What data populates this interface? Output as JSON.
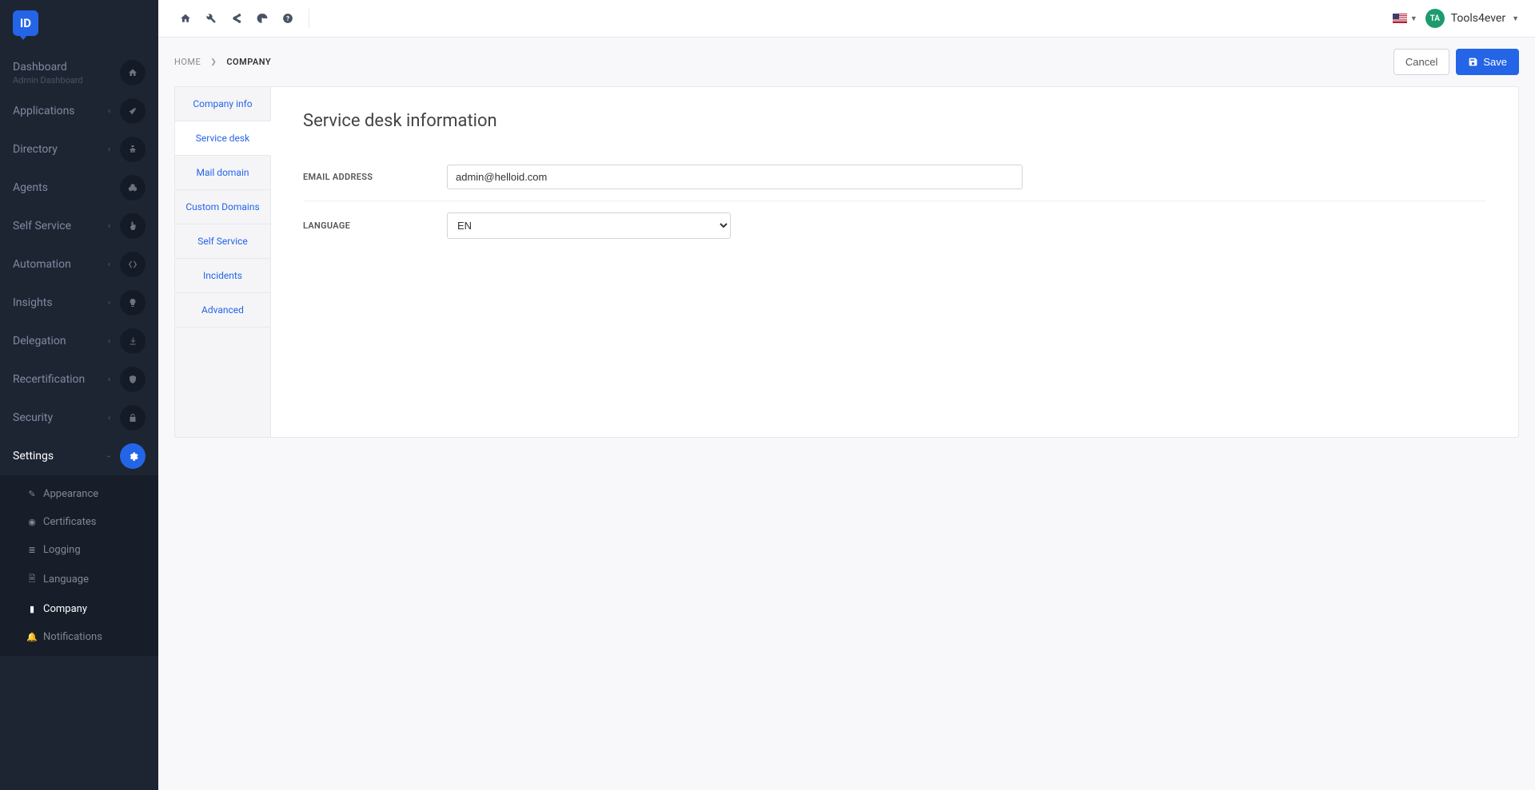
{
  "logo_text": "ID",
  "user": {
    "avatar_initials": "TA",
    "name": "Tools4ever"
  },
  "breadcrumb": {
    "home": "HOME",
    "current": "COMPANY"
  },
  "header_actions": {
    "cancel": "Cancel",
    "save": "Save"
  },
  "sidebar": {
    "items": [
      {
        "label": "Dashboard",
        "sublabel": "Admin Dashboard"
      },
      {
        "label": "Applications"
      },
      {
        "label": "Directory"
      },
      {
        "label": "Agents"
      },
      {
        "label": "Self Service"
      },
      {
        "label": "Automation"
      },
      {
        "label": "Insights"
      },
      {
        "label": "Delegation"
      },
      {
        "label": "Recertification"
      },
      {
        "label": "Security"
      },
      {
        "label": "Settings"
      }
    ],
    "settings_sub": [
      {
        "label": "Appearance"
      },
      {
        "label": "Certificates"
      },
      {
        "label": "Logging"
      },
      {
        "label": "Language"
      },
      {
        "label": "Company"
      },
      {
        "label": "Notifications"
      }
    ]
  },
  "side_tabs": [
    "Company info",
    "Service desk",
    "Mail domain",
    "Custom Domains",
    "Self Service",
    "Incidents",
    "Advanced"
  ],
  "panel": {
    "title": "Service desk information",
    "email_label": "EMAIL ADDRESS",
    "email_value": "admin@helloid.com",
    "language_label": "LANGUAGE",
    "language_value": "EN"
  }
}
